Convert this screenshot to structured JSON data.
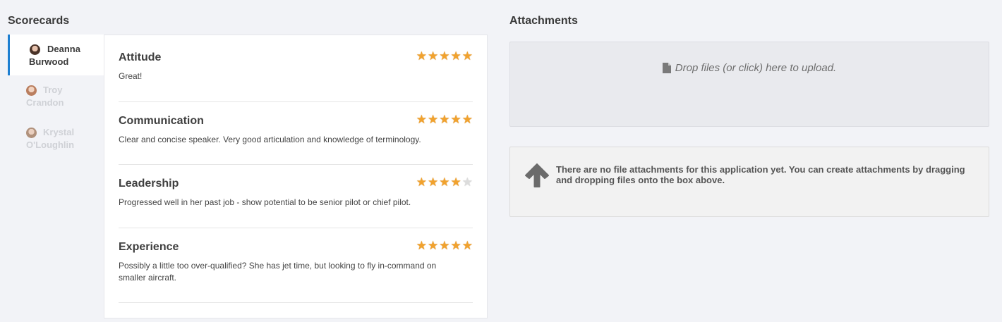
{
  "scorecards": {
    "title": "Scorecards",
    "reviewers": [
      {
        "first": "Deanna",
        "last": "Burwood",
        "active": true
      },
      {
        "first": "Troy",
        "last": "Crandon",
        "active": false
      },
      {
        "first": "Krystal",
        "last": "O'Loughlin",
        "active": false
      }
    ],
    "criteria": [
      {
        "name": "Attitude",
        "comment": "Great!",
        "rating": 5,
        "max": 5
      },
      {
        "name": "Communication",
        "comment": "Clear and concise speaker. Very good articulation and knowledge of terminology.",
        "rating": 5,
        "max": 5
      },
      {
        "name": "Leadership",
        "comment": "Progressed well in her past job - show potential to be senior pilot or chief pilot.",
        "rating": 4,
        "max": 5
      },
      {
        "name": "Experience",
        "comment": "Possibly a little too over-qualified? She has jet time, but looking to fly in-command on smaller aircraft.",
        "rating": 5,
        "max": 5
      }
    ]
  },
  "attachments": {
    "title": "Attachments",
    "dropzone_label": "Drop files (or click) here to upload.",
    "empty_message": "There are no file attachments for this application yet. You can create attachments by dragging and dropping files onto the box above."
  },
  "colors": {
    "accent": "#1e7fd1",
    "star": "#f1a22e",
    "star_empty": "#dcdcdc"
  }
}
